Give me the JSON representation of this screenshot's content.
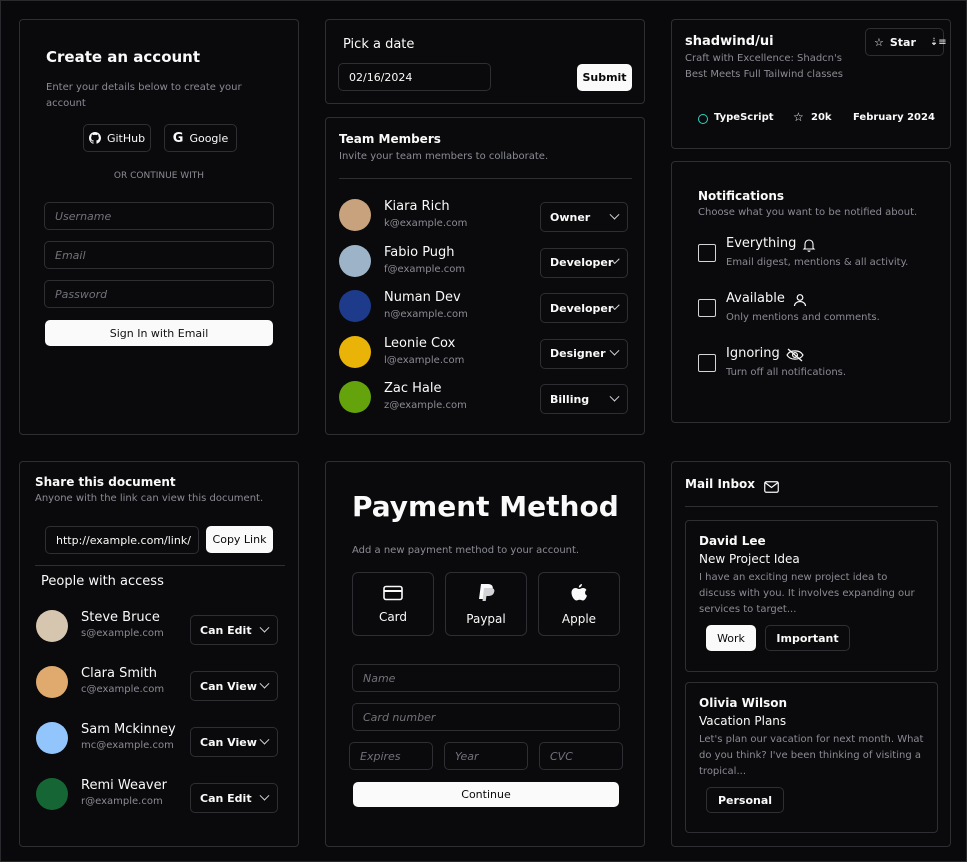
{
  "create_account": {
    "title": "Create an account",
    "subtitle": "Enter your details below to create your account",
    "github_label": "GitHub",
    "google_label": "Google",
    "divider_text": "OR CONTINUE WITH",
    "username_placeholder": "Username",
    "email_placeholder": "Email",
    "password_placeholder": "Password",
    "submit_label": "Sign In with Email"
  },
  "date_picker": {
    "title": "Pick a date",
    "value": "02/16/2024",
    "submit_label": "Submit"
  },
  "repo": {
    "name": "shadwind/ui",
    "description": "Craft with Excellence: Shadcn's Best Meets Full Tailwind classes",
    "star_label": "Star",
    "language": "TypeScript",
    "language_color": "#2dd4bf",
    "stars": "20k",
    "updated": "February 2024"
  },
  "team": {
    "title": "Team Members",
    "subtitle": "Invite your team members to collaborate.",
    "members": [
      {
        "name": "Kiara Rich",
        "email": "k@example.com",
        "role": "Owner",
        "avatar_color": "#c8a27c"
      },
      {
        "name": "Fabio Pugh",
        "email": "f@example.com",
        "role": "Developer",
        "avatar_color": "#9db4c8"
      },
      {
        "name": "Numan Dev",
        "email": "n@example.com",
        "role": "Developer",
        "avatar_color": "#1e3a8a"
      },
      {
        "name": "Leonie Cox",
        "email": "l@example.com",
        "role": "Designer",
        "avatar_color": "#eab308"
      },
      {
        "name": "Zac Hale",
        "email": "z@example.com",
        "role": "Billing",
        "avatar_color": "#65a30d"
      }
    ]
  },
  "notifications": {
    "title": "Notifications",
    "subtitle": "Choose what you want to be notified about.",
    "options": [
      {
        "label": "Everything",
        "description": "Email digest, mentions & all activity.",
        "icon": "bell-icon"
      },
      {
        "label": "Available",
        "description": "Only mentions and comments.",
        "icon": "user-icon"
      },
      {
        "label": "Ignoring",
        "description": "Turn off all notifications.",
        "icon": "eye-off-icon"
      }
    ]
  },
  "share": {
    "title": "Share this document",
    "subtitle": "Anyone with the link can view this document.",
    "link_value": "http://example.com/link/",
    "copy_label": "Copy Link",
    "people_title": "People with access",
    "people": [
      {
        "name": "Steve Bruce",
        "email": "s@example.com",
        "permission": "Can Edit",
        "avatar_color": "#d6c6b0"
      },
      {
        "name": "Clara Smith",
        "email": "c@example.com",
        "permission": "Can View",
        "avatar_color": "#e0a96d"
      },
      {
        "name": "Sam Mckinney",
        "email": "mc@example.com",
        "permission": "Can View",
        "avatar_color": "#93c5fd"
      },
      {
        "name": "Remi Weaver",
        "email": "r@example.com",
        "permission": "Can Edit",
        "avatar_color": "#166534"
      }
    ]
  },
  "payment": {
    "title": "Payment Method",
    "subtitle": "Add a new payment method to your account.",
    "methods": [
      {
        "label": "Card",
        "icon": "credit-card-icon"
      },
      {
        "label": "Paypal",
        "icon": "paypal-icon"
      },
      {
        "label": "Apple",
        "icon": "apple-icon"
      }
    ],
    "name_placeholder": "Name",
    "card_placeholder": "Card number",
    "expires_placeholder": "Expires",
    "year_placeholder": "Year",
    "cvc_placeholder": "CVC",
    "continue_label": "Continue"
  },
  "inbox": {
    "title": "Mail Inbox",
    "messages": [
      {
        "from": "David Lee",
        "subject": "New Project Idea",
        "preview": "I have an exciting new project idea to discuss with you. It involves expanding our services to target...",
        "tags": [
          "Work",
          "Important"
        ]
      },
      {
        "from": "Olivia Wilson",
        "subject": "Vacation Plans",
        "preview": "Let's plan our vacation for next month. What do you think? I've been thinking of visiting a tropical...",
        "tags": [
          "Personal"
        ]
      }
    ]
  }
}
